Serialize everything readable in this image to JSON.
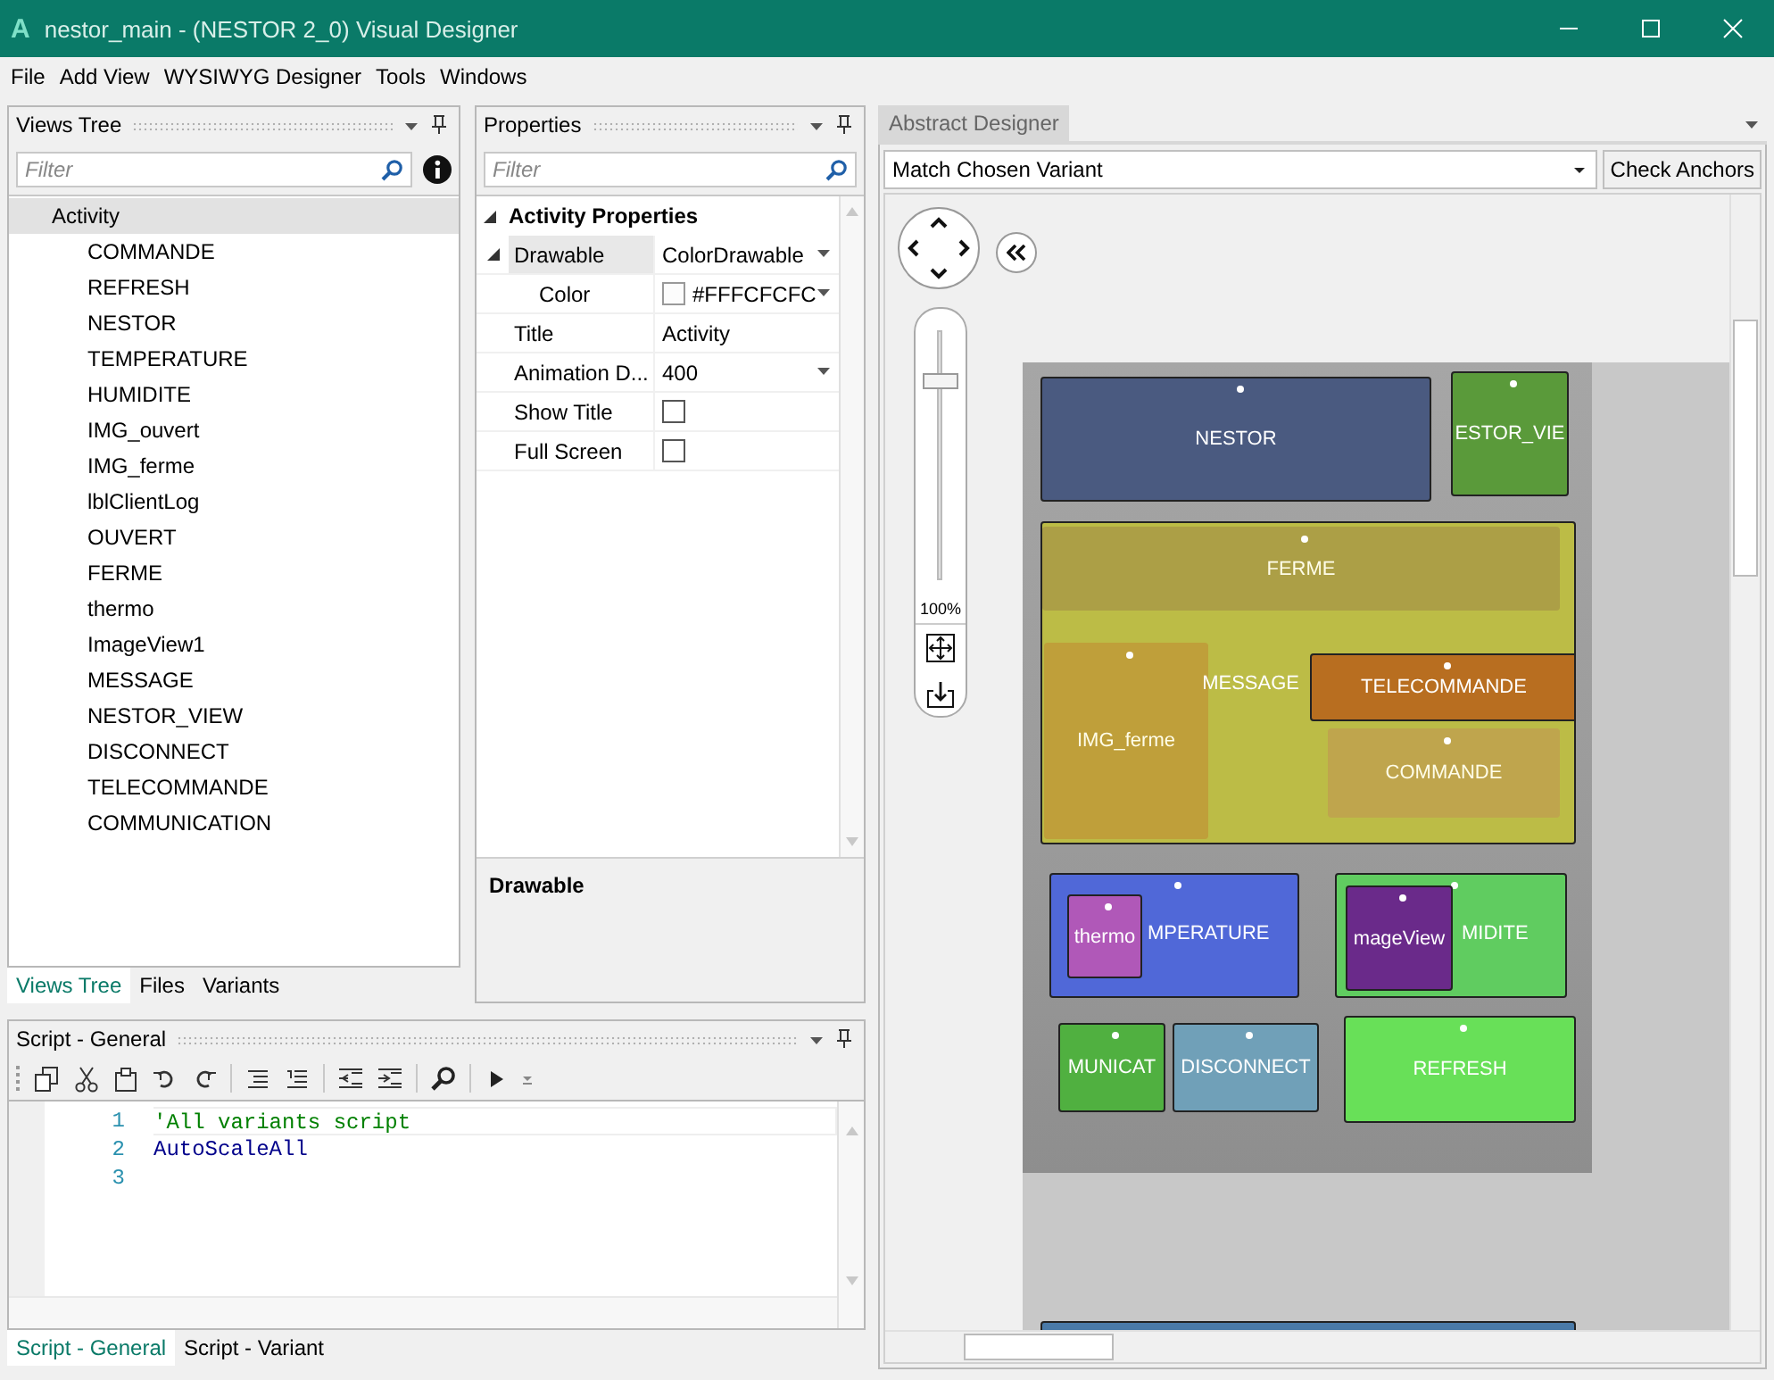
{
  "window": {
    "logo": "A",
    "title": "nestor_main - (NESTOR 2_0) Visual Designer"
  },
  "menu": [
    "File",
    "Add View",
    "WYSIWYG Designer",
    "Tools",
    "Windows"
  ],
  "views_tree": {
    "title": "Views Tree",
    "filter": {
      "placeholder": "Filter"
    },
    "items": [
      {
        "label": "Activity",
        "selected": true,
        "children": [
          {
            "label": "COMMANDE",
            "selected": false
          },
          {
            "label": "REFRESH",
            "selected": false
          },
          {
            "label": "NESTOR",
            "selected": false
          },
          {
            "label": "TEMPERATURE",
            "selected": false
          },
          {
            "label": "HUMIDITE",
            "selected": false
          },
          {
            "label": "IMG_ouvert",
            "selected": false
          },
          {
            "label": "IMG_ferme",
            "selected": false
          },
          {
            "label": "lblClientLog",
            "selected": false
          },
          {
            "label": "OUVERT",
            "selected": false
          },
          {
            "label": "FERME",
            "selected": false
          },
          {
            "label": "thermo",
            "selected": false
          },
          {
            "label": "ImageView1",
            "selected": false
          },
          {
            "label": "MESSAGE",
            "selected": false
          },
          {
            "label": "NESTOR_VIEW",
            "selected": false
          },
          {
            "label": "DISCONNECT",
            "selected": false
          },
          {
            "label": "TELECOMMANDE",
            "selected": false
          },
          {
            "label": "COMMUNICATION",
            "selected": false
          }
        ]
      }
    ],
    "tabs": [
      {
        "label": "Views Tree",
        "selected": true
      },
      {
        "label": "Files",
        "selected": false
      },
      {
        "label": "Variants",
        "selected": false
      }
    ]
  },
  "properties": {
    "title": "Properties",
    "filter": {
      "placeholder": "Filter"
    },
    "category": "Activity Properties",
    "rows": [
      {
        "name": "Drawable",
        "value": "ColorDrawable",
        "kind": "dropdown",
        "selected": true,
        "expanded": true,
        "children": [
          {
            "name": "Color",
            "value": "#FFFCFCFC",
            "kind": "color",
            "selected": false
          }
        ]
      },
      {
        "name": "Title",
        "value": "Activity",
        "kind": "text",
        "selected": false
      },
      {
        "name": "Animation D...",
        "value": "400",
        "kind": "dropdown",
        "selected": false
      },
      {
        "name": "Show Title",
        "kind": "check",
        "checked": false,
        "selected": false
      },
      {
        "name": "Full Screen",
        "kind": "check",
        "checked": false,
        "selected": false
      }
    ],
    "description": "Drawable"
  },
  "script": {
    "title": "Script - General",
    "lines": [
      {
        "number": "1",
        "code": "'All variants script",
        "kind": "comment"
      },
      {
        "number": "2",
        "code": "AutoScaleAll",
        "kind": "keyword"
      },
      {
        "number": "3"
      }
    ],
    "tabs": [
      {
        "label": "Script - General",
        "selected": true
      },
      {
        "label": "Script - Variant",
        "selected": false
      }
    ]
  },
  "designer": {
    "tab": "Abstract Designer",
    "variant": "Match Chosen Variant",
    "check_button": "Check Anchors",
    "zoom": {
      "level": 0.8,
      "reading": "100%"
    },
    "views": [
      {
        "label": "NESTOR",
        "color": "#4a5a80",
        "transparent": false
      },
      {
        "label": "ESTOR_VIE",
        "color": "#5a9a3a",
        "transparent": false
      },
      {
        "label": "MESSAGE",
        "color": "#bcbc46",
        "transparent": false,
        "children": [
          {
            "label": "FERME",
            "color": "#b0a048",
            "transparent": true
          },
          {
            "label": "IMG_ferme",
            "color": "#c8a038",
            "transparent": true
          },
          {
            "label": "TELECOMMANDE",
            "color": "#b86e20",
            "transparent": false
          },
          {
            "label": "COMMANDE",
            "color": "#c8a850",
            "transparent": true
          }
        ]
      },
      {
        "label": "MPERATURE",
        "color": "#5068d8",
        "transparent": false,
        "children": [
          {
            "label": "thermo",
            "color": "#b058b8",
            "transparent": false
          }
        ]
      },
      {
        "label": "MIDITE",
        "color": "#60cc60",
        "transparent": false,
        "children": [
          {
            "label": "mageView",
            "color": "#6a2a8a",
            "transparent": false
          }
        ]
      },
      {
        "label": "MUNICAT",
        "color": "#50b040",
        "transparent": false
      },
      {
        "label": "DISCONNECT",
        "color": "#70a0b8",
        "transparent": false
      },
      {
        "label": "REFRESH",
        "color": "#68e058",
        "transparent": false
      },
      {
        "color": "#4a7aa8",
        "transparent": false
      }
    ]
  }
}
